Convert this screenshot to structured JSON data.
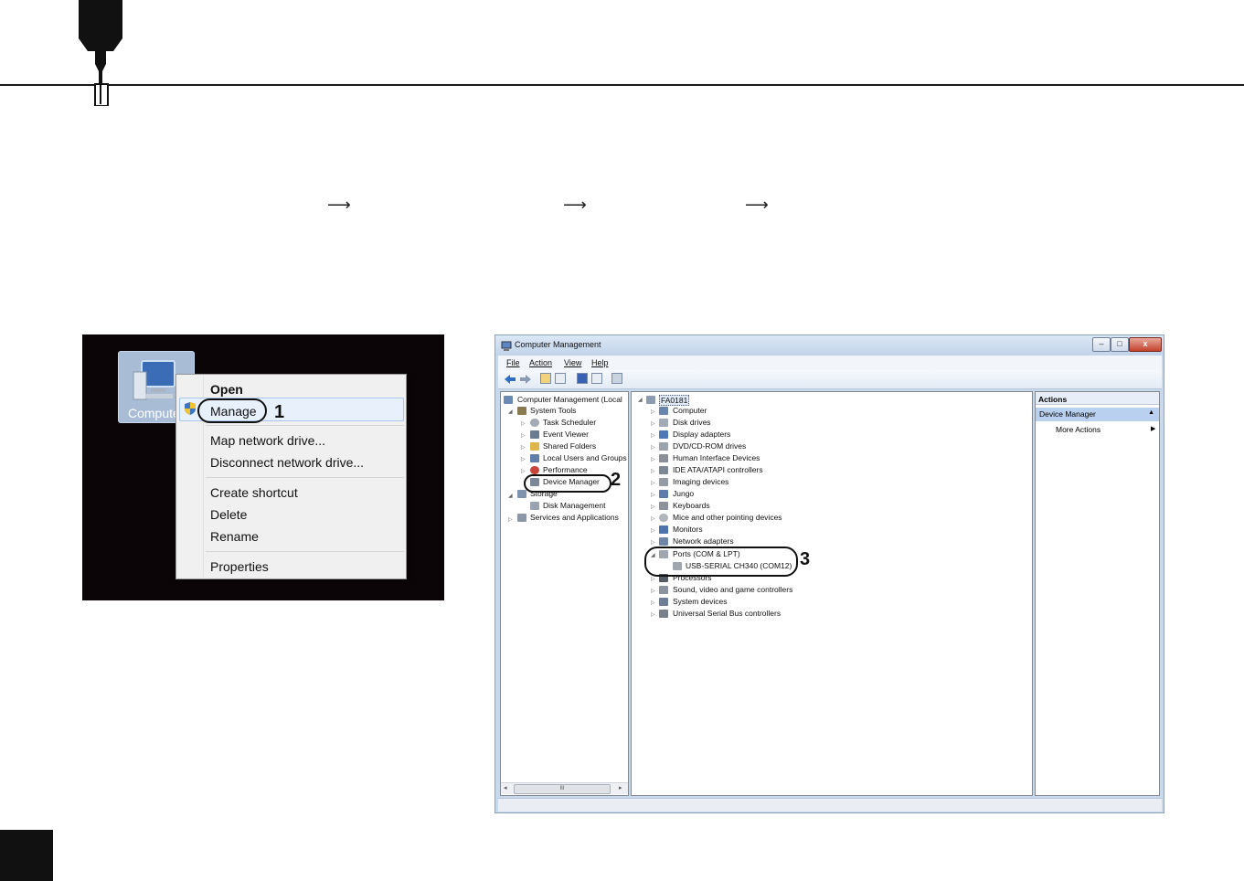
{
  "context_menu_shot": {
    "desktop_icon_label": "Compute",
    "menu_items": [
      {
        "label": "Open",
        "bold": true
      },
      {
        "label": "Manage",
        "bold": false
      },
      {
        "label": "Map network drive...",
        "bold": false
      },
      {
        "label": "Disconnect network drive...",
        "bold": false
      },
      {
        "label": "Create shortcut",
        "bold": false
      },
      {
        "label": "Delete",
        "bold": false
      },
      {
        "label": "Rename",
        "bold": false
      },
      {
        "label": "Properties",
        "bold": false
      }
    ],
    "callout_number": "1"
  },
  "arrows": [
    "⟶",
    "⟶",
    "⟶"
  ],
  "computer_management": {
    "title": "Computer Management",
    "window_buttons": {
      "minimize": "–",
      "maximize": "□",
      "close": "x"
    },
    "menu": [
      "File",
      "Action",
      "View",
      "Help"
    ],
    "left_tree": [
      "Computer Management (Local",
      "System Tools",
      "Task Scheduler",
      "Event Viewer",
      "Shared Folders",
      "Local Users and Groups",
      "Performance",
      "Device Manager",
      "Storage",
      "Disk Management",
      "Services and Applications"
    ],
    "scroll_thumb": "III",
    "device_root": "FA0181",
    "devices": [
      "Computer",
      "Disk drives",
      "Display adapters",
      "DVD/CD-ROM drives",
      "Human Interface Devices",
      "IDE ATA/ATAPI controllers",
      "Imaging devices",
      "Jungo",
      "Keyboards",
      "Mice and other pointing devices",
      "Monitors",
      "Network adapters",
      "Ports (COM & LPT)",
      "USB-SERIAL CH340 (COM12)",
      "Processors",
      "Sound, video and game controllers",
      "System devices",
      "Universal Serial Bus controllers"
    ],
    "actions": {
      "header": "Actions",
      "selected": "Device Manager",
      "more": "More Actions"
    },
    "callouts": [
      "2",
      "3"
    ]
  },
  "colors": {
    "dark": "#111111",
    "window_frame": "#c9d9ec",
    "selection": "#e8f0fb"
  }
}
